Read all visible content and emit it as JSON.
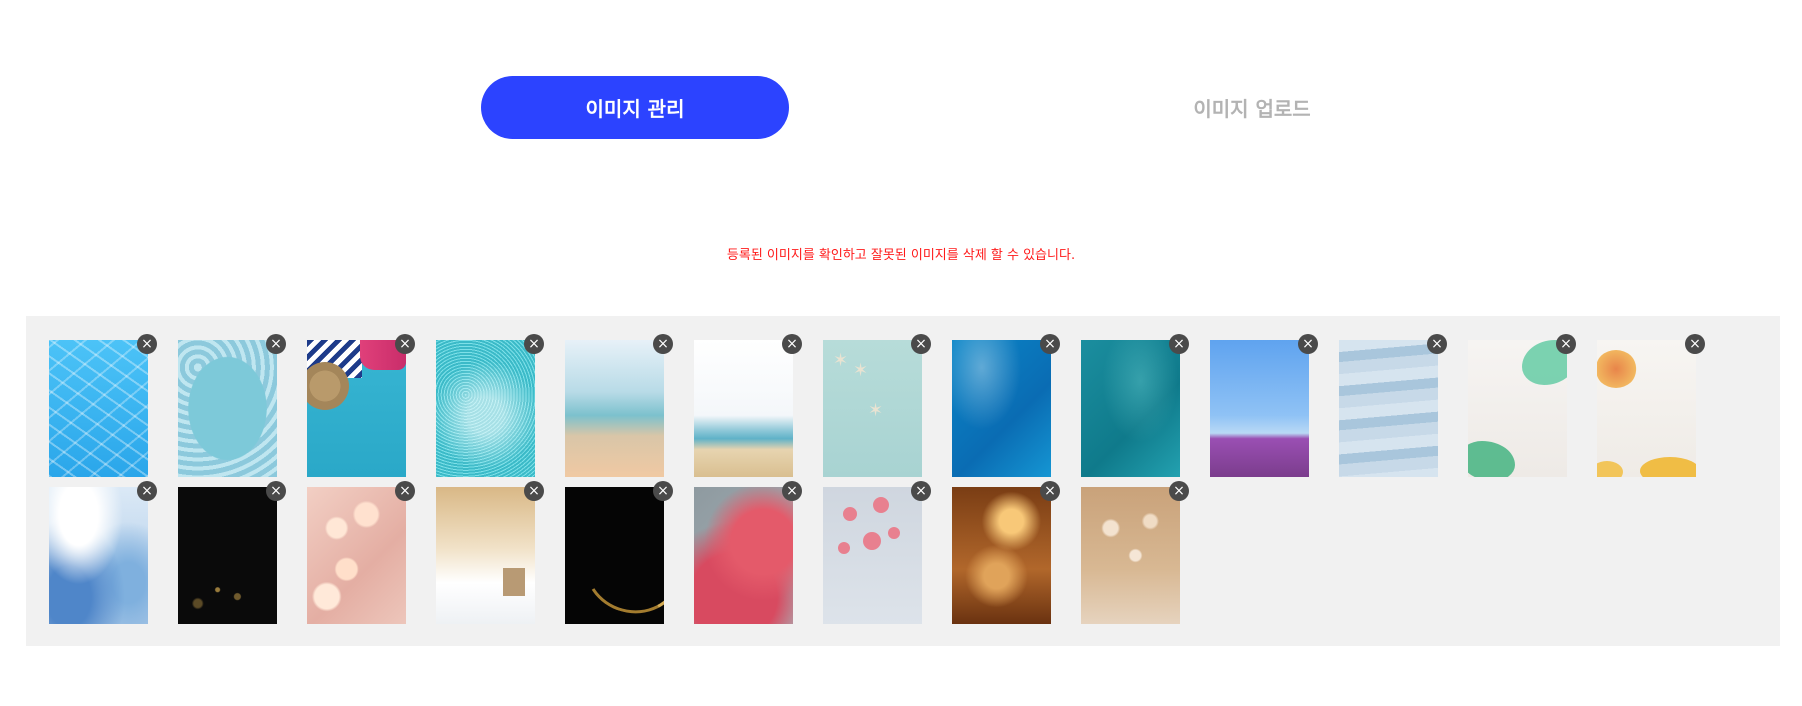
{
  "tabs": [
    {
      "label": "이미지 관리",
      "active": true
    },
    {
      "label": "이미지 업로드",
      "active": false
    }
  ],
  "notice": "등록된 이미지를 확인하고 잘못된 이미지를 삭제 할 수 있습니다.",
  "colors": {
    "accent": "#2c43ff",
    "notice": "#ff1a1a",
    "panel": "#f1f1f1",
    "delete_badge": "#4a4a4a"
  },
  "delete_icon": "×",
  "thumbnails": [
    {
      "subject": "pool water"
    },
    {
      "subject": "ice frame"
    },
    {
      "subject": "beach items"
    },
    {
      "subject": "glitter teal"
    },
    {
      "subject": "blurred beach"
    },
    {
      "subject": "seashore"
    },
    {
      "subject": "starfish"
    },
    {
      "subject": "blue water"
    },
    {
      "subject": "teal water"
    },
    {
      "subject": "sky flowers"
    },
    {
      "subject": "blue mountains"
    },
    {
      "subject": "green watercolor"
    },
    {
      "subject": "yellow watercolor"
    },
    {
      "subject": "blue watercolor"
    },
    {
      "subject": "black glitter"
    },
    {
      "subject": "cherry blossom"
    },
    {
      "subject": "gold snow"
    },
    {
      "subject": "gold arc"
    },
    {
      "subject": "pink flowers"
    },
    {
      "subject": "blossom branch"
    },
    {
      "subject": "amber bokeh"
    },
    {
      "subject": "ornament bokeh"
    }
  ]
}
